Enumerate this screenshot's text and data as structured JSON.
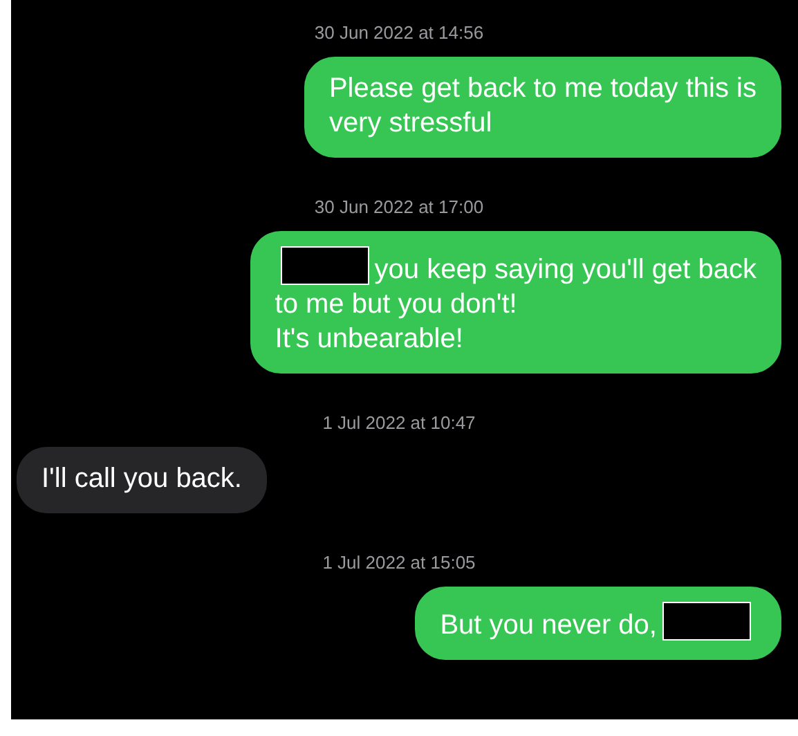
{
  "messages": [
    {
      "kind": "timestamp",
      "text": "30 Jun 2022 at 14:56"
    },
    {
      "kind": "sent",
      "parts": [
        {
          "kind": "text",
          "text": "Please get back to me today this is"
        },
        {
          "kind": "break"
        },
        {
          "kind": "text",
          "text": "very stressful"
        }
      ]
    },
    {
      "kind": "timestamp",
      "text": "30 Jun 2022 at 17:00"
    },
    {
      "kind": "sent",
      "parts": [
        {
          "kind": "redacted"
        },
        {
          "kind": "text",
          "text": "you keep saying you'll get back"
        },
        {
          "kind": "break"
        },
        {
          "kind": "text",
          "text": "to me but you don't!"
        },
        {
          "kind": "break"
        },
        {
          "kind": "text",
          "text": "It's unbearable!"
        }
      ]
    },
    {
      "kind": "timestamp",
      "text": "1 Jul 2022 at 10:47"
    },
    {
      "kind": "received",
      "parts": [
        {
          "kind": "text",
          "text": "I'll call you back."
        }
      ]
    },
    {
      "kind": "timestamp",
      "text": "1 Jul 2022 at 15:05"
    },
    {
      "kind": "sent",
      "parts": [
        {
          "kind": "text",
          "text": "But you never do,"
        },
        {
          "kind": "redacted"
        }
      ]
    }
  ]
}
